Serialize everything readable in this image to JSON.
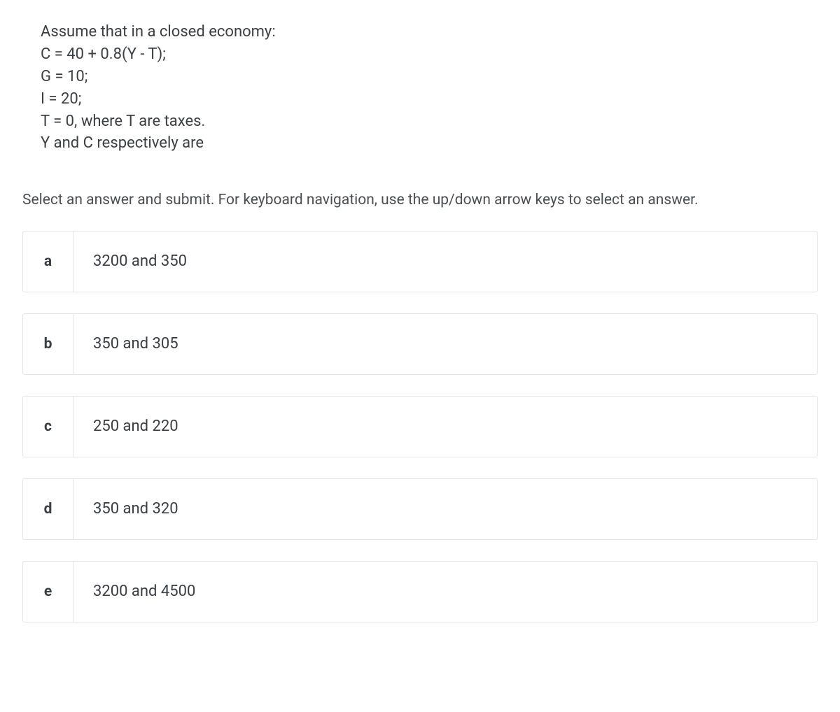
{
  "question": {
    "lines": [
      "Assume that in a closed economy:",
      "C = 40 + 0.8(Y - T);",
      "G = 10;",
      "I = 20;",
      "T = 0, where T are taxes.",
      "Y and C respectively are"
    ]
  },
  "instruction": "Select an answer and submit. For keyboard navigation, use the up/down arrow keys to select an answer.",
  "options": [
    {
      "letter": "a",
      "text": "3200 and 350"
    },
    {
      "letter": "b",
      "text": "350 and 305"
    },
    {
      "letter": "c",
      "text": "250 and 220"
    },
    {
      "letter": "d",
      "text": "350 and 320"
    },
    {
      "letter": "e",
      "text": "3200 and 4500"
    }
  ]
}
